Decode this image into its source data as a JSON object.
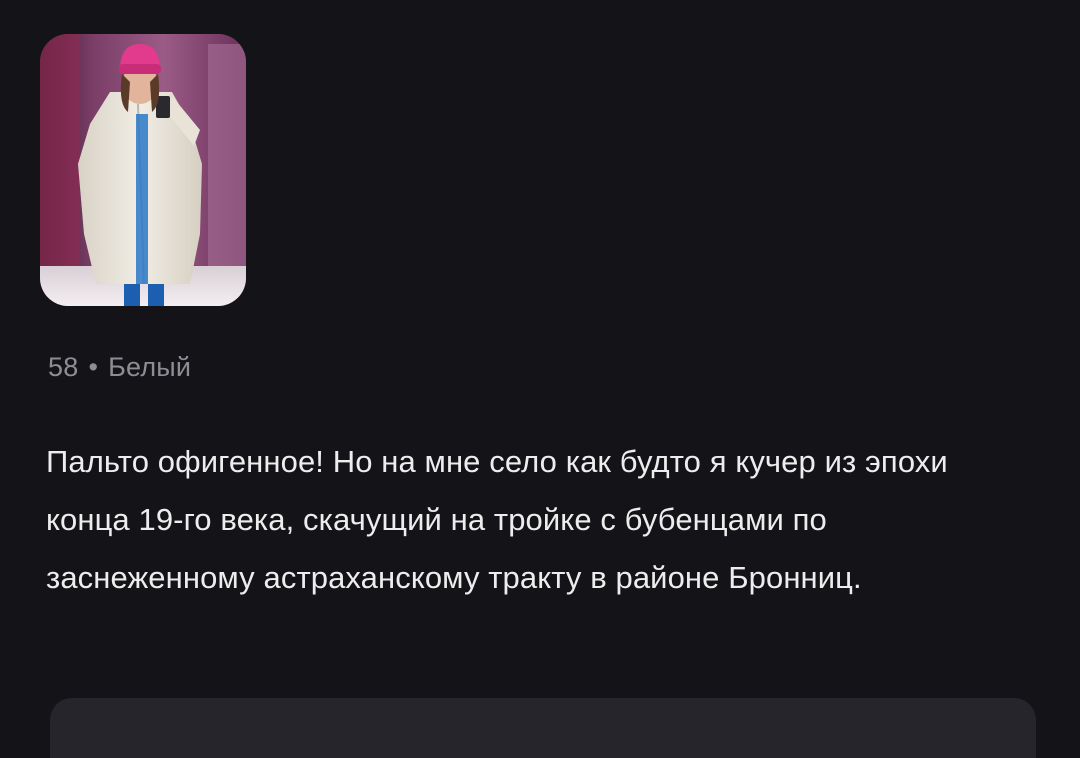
{
  "review": {
    "photo": {
      "description_icon": "review-photo",
      "colors": {
        "background": "#5a2e4a",
        "coat": "#ece7dc",
        "hat": "#e23a8c",
        "pants": "#1c5fb0"
      }
    },
    "size": "58",
    "separator": "•",
    "color": "Белый",
    "text": "Пальто офигенное! Но на мне село как будто я кучер из эпохи конца 19-го века, скачущий на тройке с бубенцами по заснеженному астраханскому тракту в районе Бронниц."
  },
  "theme": {
    "background": "#141317",
    "text": "#ededed",
    "muted": "#8e8d93",
    "panel": "#26252b"
  }
}
